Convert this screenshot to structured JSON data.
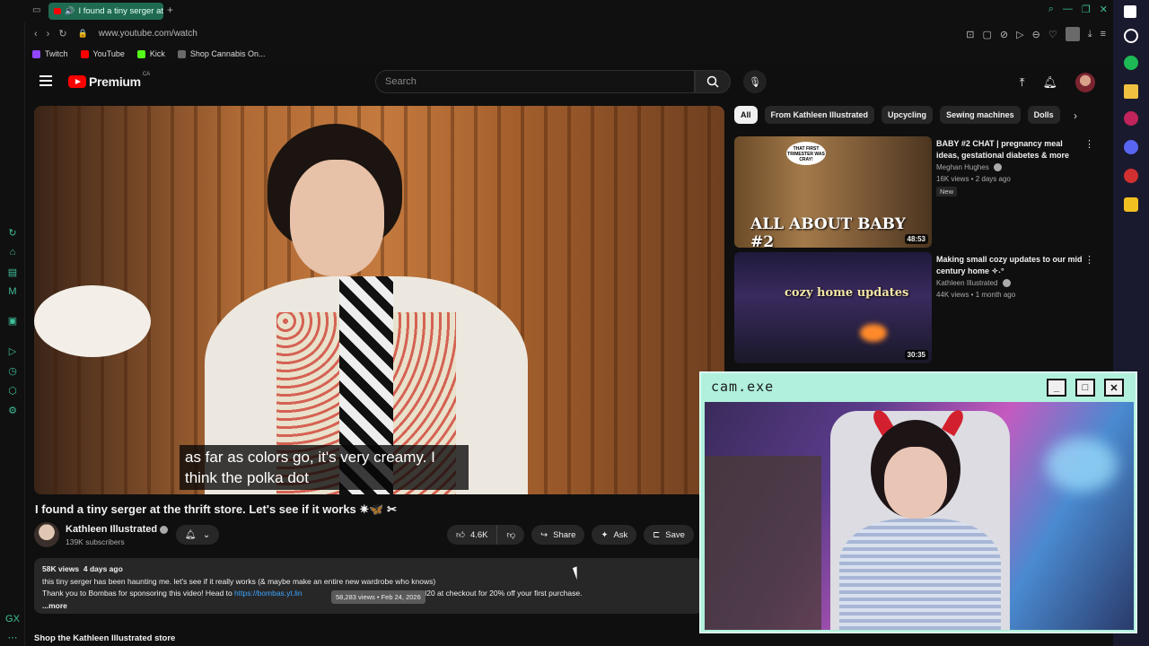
{
  "browser": {
    "tab_title": "I found a tiny serger at",
    "url": "www.youtube.com/watch",
    "bookmarks": [
      {
        "label": "Twitch",
        "color": "#9146ff"
      },
      {
        "label": "YouTube",
        "color": "#ff0000"
      },
      {
        "label": "Kick",
        "color": "#53fc18"
      },
      {
        "label": "Shop Cannabis On...",
        "color": "#6a6a6a"
      }
    ]
  },
  "header": {
    "logo_word": "Premium",
    "region": "CA",
    "search_placeholder": "Search"
  },
  "video": {
    "caption_line1": "as far as colors go, it's very creamy. I",
    "caption_line2": "think the polka dot",
    "title": "I found a tiny serger at the thrift store. Let's see if it works ✷🦋 ✂",
    "channel": "Kathleen Illustrated",
    "subscribers": "139K subscribers",
    "likes": "4.6K",
    "share_label": "Share",
    "ask_label": "Ask",
    "save_label": "Save"
  },
  "description": {
    "views": "58K views",
    "age": "4 days ago",
    "line1": "this tiny serger has been haunting me. let's see if it really works (& maybe make an entire new wardrobe who knows)",
    "line2_start": "Thank you to Bombas for sponsoring this video! Head to ",
    "link": "https://bombas.yt.lin",
    "line2_end": "ATHLEEN20 at checkout for 20% off your first purchase.",
    "more": "...more",
    "tooltip": "58,283 views • Feb 24, 2026"
  },
  "store_label": "Shop the Kathleen Illustrated store",
  "chips": [
    "All",
    "From Kathleen Illustrated",
    "Upcycling",
    "Sewing machines",
    "Dolls"
  ],
  "recommendations": [
    {
      "title": "BABY #2 CHAT | pregnancy meal ideas, gestational diabetes & more",
      "channel": "Meghan Hughes",
      "stats": "16K views • 2 days ago",
      "badge": "New",
      "duration": "48:53",
      "thumb_text": "ALL ABOUT BABY #2",
      "thumb_bubble": "THAT FIRST TRIMESTER WAS CRAY!"
    },
    {
      "title": "Making small cozy updates to our mid century home ✧˖°",
      "channel": "Kathleen Illustrated",
      "stats": "44K views • 1 month ago",
      "duration": "30:35",
      "thumb_text": "cozy home updates"
    }
  ],
  "cam": {
    "title": "cam.exe",
    "minimize": "_",
    "maximize": "□",
    "close": "✕"
  }
}
